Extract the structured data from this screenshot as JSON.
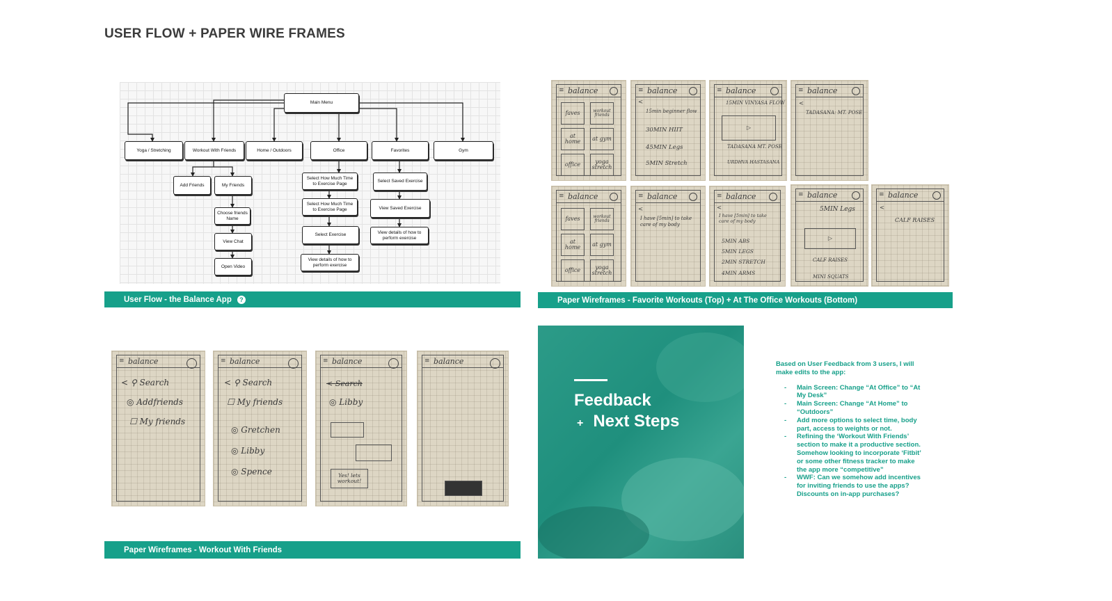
{
  "page": {
    "title": "USER FLOW + PAPER WIRE FRAMES"
  },
  "user_flow": {
    "caption": "User Flow - the Balance App",
    "nodes": {
      "main_menu": "Main Menu",
      "yoga": "Yoga / Stretching",
      "workout_friends": "Workout With Friends",
      "home_outdoors": "Home / Outdoors",
      "office": "Office",
      "favorites": "Favorites",
      "gym": "Gym",
      "add_friends": "Add Friends",
      "my_friends": "My Friends",
      "choose_friends": "Choose friends Name",
      "view_chat": "View Chat",
      "open_video": "Open Video",
      "select_time_1": "Select How Much Time to Exercise Page",
      "select_time_2": "Select How Much Time to Exercise Page",
      "select_exercise": "Select Exercise",
      "view_details_office": "View details of how to perform exercise",
      "select_saved": "Select Saved Exercise",
      "view_saved": "View Saved Exercise",
      "view_details_fav": "View details of how to perform exercise"
    }
  },
  "favorites_wireframes": {
    "caption": "Paper Wireframes - Favorite Workouts (Top) + At The Office Workouts (Bottom)",
    "brand": "balance",
    "grid_labels": [
      "faves",
      "workout friends",
      "at home",
      "at gym",
      "office",
      "yoga stretch"
    ],
    "list_workouts": [
      "15min beginner flow",
      "30MIN HIIT",
      "45MIN Legs",
      "5MIN Stretch"
    ],
    "video_screen": [
      "15MIN VINYASA FLOW",
      "TADASANA MT. POSE",
      "URDHVA HASTASANA"
    ],
    "pose_screen": "TADASANA: MT. POSE",
    "office_time": "I have [5min] to take care of my body",
    "office_time_full": "I have [5min] to take care of my body",
    "office_options": [
      "5MIN ABS",
      "5MIN LEGS",
      "2MIN STRETCH",
      "4MIN ARMS"
    ],
    "legs_screen": [
      "5MIN Legs",
      "CALF RAISES",
      "MINI SQUATS"
    ],
    "calf_screen": "CALF RAISES"
  },
  "friends_wireframes": {
    "caption": "Paper Wireframes - Workout With Friends",
    "brand": "balance",
    "search": "Search",
    "add_friends": "Addfriends",
    "my_friends": "My friends",
    "friends": [
      "Gretchen",
      "Libby",
      "Spence"
    ],
    "chat_name": "Libby",
    "crossed_search": "Search",
    "chat_msg": "Yes! lets workout!"
  },
  "feedback": {
    "heading_1": "Feedback",
    "plus": "+",
    "heading_2": "Next Steps",
    "intro": "Based on User Feedback from 3 users, I will make edits to the app:",
    "items": [
      "Main Screen: Change “At Office” to “At My Desk”",
      "Main Screen: Change “At Home” to “Outdoors”",
      "Add more options to select time, body part, access to weights or not.",
      "Refining the ‘Workout With Friends’ section to make it a productive section. Somehow looking to incorporate ‘Fitbit’ or some other fitness tracker to make the app more “competitive”",
      "WWF: Can we somehow add incentives for inviting friends to use the apps? Discounts on in-app purchases?"
    ]
  },
  "colors": {
    "accent": "#17a08a",
    "title": "#3b3b3b"
  }
}
